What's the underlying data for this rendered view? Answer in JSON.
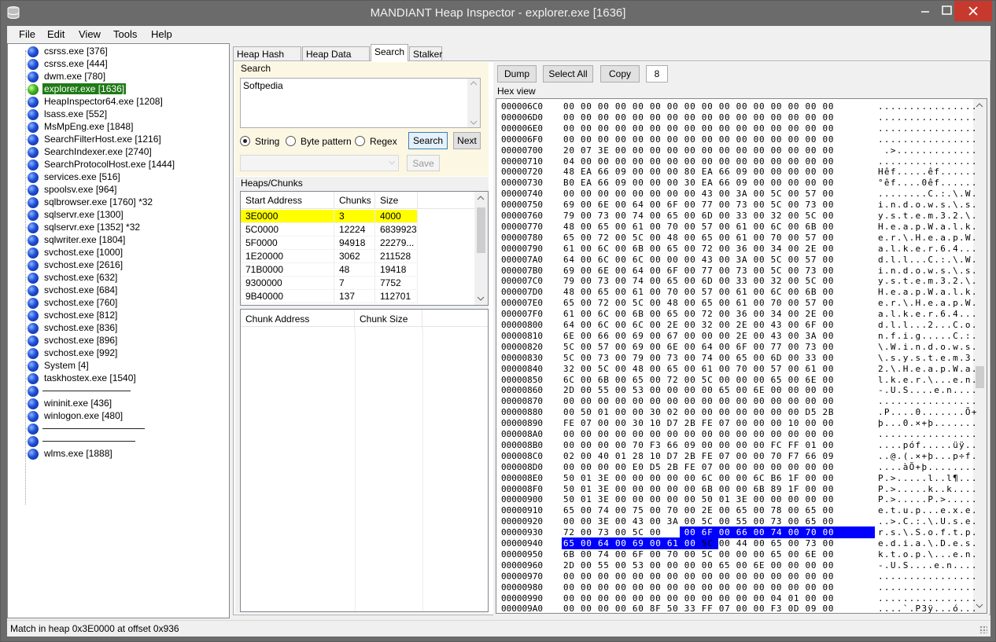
{
  "window": {
    "title": "MANDIANT Heap Inspector - explorer.exe [1636]",
    "close_color": "#c7382d"
  },
  "menu": [
    "File",
    "Edit",
    "View",
    "Tools",
    "Help"
  ],
  "processes": [
    {
      "label": "csrss.exe [376]"
    },
    {
      "label": "csrss.exe [444]"
    },
    {
      "label": "dwm.exe [780]"
    },
    {
      "label": "explorer.exe [1636]",
      "selected": true
    },
    {
      "label": "HeapInspector64.exe [1208]"
    },
    {
      "label": "lsass.exe [552]"
    },
    {
      "label": "MsMpEng.exe [1848]"
    },
    {
      "label": "SearchFilterHost.exe [1216]"
    },
    {
      "label": "SearchIndexer.exe [2740]"
    },
    {
      "label": "SearchProtocolHost.exe [1444]"
    },
    {
      "label": "services.exe [516]"
    },
    {
      "label": "spoolsv.exe [964]"
    },
    {
      "label": "sqlbrowser.exe [1760] *32"
    },
    {
      "label": "sqlservr.exe [1300]"
    },
    {
      "label": "sqlservr.exe [1352] *32"
    },
    {
      "label": "sqlwriter.exe [1804]"
    },
    {
      "label": "svchost.exe [1000]"
    },
    {
      "label": "svchost.exe [2616]"
    },
    {
      "label": "svchost.exe [632]"
    },
    {
      "label": "svchost.exe [684]"
    },
    {
      "label": "svchost.exe [760]"
    },
    {
      "label": "svchost.exe [812]"
    },
    {
      "label": "svchost.exe [836]"
    },
    {
      "label": "svchost.exe [896]"
    },
    {
      "label": "svchost.exe [992]"
    },
    {
      "label": "System [4]"
    },
    {
      "label": "taskhostex.exe [1540]"
    },
    {
      "label": "",
      "redacted": true
    },
    {
      "label": "wininit.exe [436]"
    },
    {
      "label": "winlogon.exe [480]"
    },
    {
      "label": "",
      "redacted": true
    },
    {
      "label": "",
      "redacted": true
    },
    {
      "label": "wlms.exe [1888]"
    }
  ],
  "tabs": [
    "Heap Hash Map",
    "Heap Data Map",
    "Search",
    "Stalker"
  ],
  "active_tab": "Search",
  "search": {
    "group_title": "Search",
    "text": "Softpedia",
    "options": [
      "String",
      "Byte pattern",
      "Regex"
    ],
    "selected_option": "String",
    "search_button": "Search",
    "next_button": "Next",
    "save_button": "Save"
  },
  "heaps": {
    "group_title": "Heaps/Chunks",
    "columns": [
      "Start Address",
      "Chunks",
      "Size"
    ],
    "rows": [
      [
        "3E0000",
        "3",
        "4000"
      ],
      [
        "5C0000",
        "12224",
        "6839923"
      ],
      [
        "5F0000",
        "94918",
        "22279..."
      ],
      [
        "1E20000",
        "3062",
        "211528"
      ],
      [
        "71B0000",
        "48",
        "19418"
      ],
      [
        "9300000",
        "7",
        "7752"
      ],
      [
        "9B40000",
        "137",
        "112701"
      ]
    ],
    "highlight_row": 0,
    "highlight_color": "#ffff00",
    "chunk_columns": [
      "Chunk Address",
      "Chunk Size"
    ]
  },
  "hex": {
    "buttons": [
      "Dump",
      "Select All",
      "Copy",
      "8"
    ],
    "group_title": "Hex view",
    "selection_color": "#0000ff",
    "rows": [
      {
        "off": "000006C0",
        "bytes": "00 00 00 00 00 00 00 00 00 00 00 00 00 00 00 00",
        "ascii": "................"
      },
      {
        "off": "000006D0",
        "bytes": "00 00 00 00 00 00 00 00 00 00 00 00 00 00 00 00",
        "ascii": "................"
      },
      {
        "off": "000006E0",
        "bytes": "00 00 00 00 00 00 00 00 00 00 00 00 00 00 00 00",
        "ascii": "................"
      },
      {
        "off": "000006F0",
        "bytes": "00 00 00 00 00 00 00 00 00 00 00 00 00 00 00 00",
        "ascii": "................"
      },
      {
        "off": "00000700",
        "bytes": "20 07 3E 00 00 00 00 00 00 00 00 00 00 00 00 00",
        "ascii": " .>............."
      },
      {
        "off": "00000710",
        "bytes": "04 00 00 00 00 00 00 00 00 00 00 00 00 00 00 00",
        "ascii": "................"
      },
      {
        "off": "00000720",
        "bytes": "48 EA 66 09 00 00 00 80 EA 66 09 00 00 00 00 00",
        "ascii": "Hêf.....êf......"
      },
      {
        "off": "00000730",
        "bytes": "B0 EA 66 09 00 00 00 30 EA 66 09 00 00 00 00 00",
        "ascii": "°êf....0êf......"
      },
      {
        "off": "00000740",
        "bytes": "00 00 00 00 00 00 00 00 43 00 3A 00 5C 00 57 00",
        "ascii": "........C.:.\\.W."
      },
      {
        "off": "00000750",
        "bytes": "69 00 6E 00 64 00 6F 00 77 00 73 00 5C 00 73 00",
        "ascii": "i.n.d.o.w.s.\\.s."
      },
      {
        "off": "00000760",
        "bytes": "79 00 73 00 74 00 65 00 6D 00 33 00 32 00 5C 00",
        "ascii": "y.s.t.e.m.3.2.\\."
      },
      {
        "off": "00000770",
        "bytes": "48 00 65 00 61 00 70 00 57 00 61 00 6C 00 6B 00",
        "ascii": "H.e.a.p.W.a.l.k."
      },
      {
        "off": "00000780",
        "bytes": "65 00 72 00 5C 00 48 00 65 00 61 00 70 00 57 00",
        "ascii": "e.r.\\.H.e.a.p.W."
      },
      {
        "off": "00000790",
        "bytes": "61 00 6C 00 6B 00 65 00 72 00 36 00 34 00 2E 00",
        "ascii": "a.l.k.e.r.6.4..."
      },
      {
        "off": "000007A0",
        "bytes": "64 00 6C 00 6C 00 00 00 43 00 3A 00 5C 00 57 00",
        "ascii": "d.l.l...C.:.\\.W."
      },
      {
        "off": "000007B0",
        "bytes": "69 00 6E 00 64 00 6F 00 77 00 73 00 5C 00 73 00",
        "ascii": "i.n.d.o.w.s.\\.s."
      },
      {
        "off": "000007C0",
        "bytes": "79 00 73 00 74 00 65 00 6D 00 33 00 32 00 5C 00",
        "ascii": "y.s.t.e.m.3.2.\\."
      },
      {
        "off": "000007D0",
        "bytes": "48 00 65 00 61 00 70 00 57 00 61 00 6C 00 6B 00",
        "ascii": "H.e.a.p.W.a.l.k."
      },
      {
        "off": "000007E0",
        "bytes": "65 00 72 00 5C 00 48 00 65 00 61 00 70 00 57 00",
        "ascii": "e.r.\\.H.e.a.p.W."
      },
      {
        "off": "000007F0",
        "bytes": "61 00 6C 00 6B 00 65 00 72 00 36 00 34 00 2E 00",
        "ascii": "a.l.k.e.r.6.4..."
      },
      {
        "off": "00000800",
        "bytes": "64 00 6C 00 6C 00 2E 00 32 00 2E 00 43 00 6F 00",
        "ascii": "d.l.l...2...C.o."
      },
      {
        "off": "00000810",
        "bytes": "6E 00 66 00 69 00 67 00 00 00 2E 00 43 00 3A 00",
        "ascii": "n.f.i.g.....C.:."
      },
      {
        "off": "00000820",
        "bytes": "5C 00 57 00 69 00 6E 00 64 00 6F 00 77 00 73 00",
        "ascii": "\\.W.i.n.d.o.w.s."
      },
      {
        "off": "00000830",
        "bytes": "5C 00 73 00 79 00 73 00 74 00 65 00 6D 00 33 00",
        "ascii": "\\.s.y.s.t.e.m.3."
      },
      {
        "off": "00000840",
        "bytes": "32 00 5C 00 48 00 65 00 61 00 70 00 57 00 61 00",
        "ascii": "2.\\.H.e.a.p.W.a."
      },
      {
        "off": "00000850",
        "bytes": "6C 00 6B 00 65 00 72 00 5C 00 00 00 65 00 6E 00",
        "ascii": "l.k.e.r.\\...e.n."
      },
      {
        "off": "00000860",
        "bytes": "2D 00 55 00 53 00 00 00 00 65 00 6E 00 00 00 00",
        "ascii": "-.U.S....e.n...."
      },
      {
        "off": "00000870",
        "bytes": "00 00 00 00 00 00 00 00 00 00 00 00 00 00 00 00",
        "ascii": "................"
      },
      {
        "off": "00000880",
        "bytes": "00 50 01 00 00 30 02 00 00 00 00 00 00 00 D5 2B",
        "ascii": ".P....0.......Õ+"
      },
      {
        "off": "00000890",
        "bytes": "FE 07 00 00 30 10 D7 2B FE 07 00 00 00 10 00 00",
        "ascii": "þ...0.×+þ......."
      },
      {
        "off": "000008A0",
        "bytes": "00 00 00 00 00 00 00 00 00 00 00 00 00 00 00 00",
        "ascii": "................"
      },
      {
        "off": "000008B0",
        "bytes": "00 00 00 00 70 F3 66 09 00 00 00 00 FC FF 01 00",
        "ascii": "....póf.....üÿ.."
      },
      {
        "off": "000008C0",
        "bytes": "02 00 40 01 28 10 D7 2B FE 07 00 00 70 F7 66 09",
        "ascii": "..@.(.×+þ...p÷f."
      },
      {
        "off": "000008D0",
        "bytes": "00 00 00 00 E0 D5 2B FE 07 00 00 00 00 00 00 00",
        "ascii": "....àÕ+þ........"
      },
      {
        "off": "000008E0",
        "bytes": "50 01 3E 00 00 00 00 00 6C 00 00 6C B6 1F 00 00",
        "ascii": "P.>.....l..l¶..."
      },
      {
        "off": "000008F0",
        "bytes": "50 01 3E 00 00 00 00 00 6B 00 00 6B 89 1F 00 00",
        "ascii": "P.>.....k..k...."
      },
      {
        "off": "00000900",
        "bytes": "50 01 3E 00 00 00 00 00 50 01 3E 00 00 00 00 00",
        "ascii": "P.>.....P.>....."
      },
      {
        "off": "00000910",
        "bytes": "65 00 74 00 75 00 70 00 2E 00 65 00 78 00 65 00",
        "ascii": "e.t.u.p...e.x.e."
      },
      {
        "off": "00000920",
        "bytes": "00 00 3E 00 43 00 3A 00 5C 00 55 00 73 00 65 00",
        "ascii": "..>.C.:.\\.U.s.e."
      },
      {
        "off": "00000930",
        "bytes": "72 00 73 00 5C 00 53 00 6F 00 66 00 74 00 70 00",
        "ascii": "r.s.\\.S.o.f.t.p.",
        "sel_start": 6,
        "sel_end": 16
      },
      {
        "off": "00000940",
        "bytes": "65 00 64 00 69 00 61 00 5C 00 44 00 65 00 73 00",
        "ascii": "e.d.i.a.\\.D.e.s.",
        "sel_start": 0,
        "sel_end": 8
      },
      {
        "off": "00000950",
        "bytes": "6B 00 74 00 6F 00 70 00 5C 00 00 00 65 00 6E 00",
        "ascii": "k.t.o.p.\\...e.n."
      },
      {
        "off": "00000960",
        "bytes": "2D 00 55 00 53 00 00 00 00 65 00 6E 00 00 00 00",
        "ascii": "-.U.S....e.n...."
      },
      {
        "off": "00000970",
        "bytes": "00 00 00 00 00 00 00 00 00 00 00 00 00 00 00 00",
        "ascii": "................"
      },
      {
        "off": "00000980",
        "bytes": "00 00 00 00 00 00 00 00 00 00 00 00 00 00 00 00",
        "ascii": "................"
      },
      {
        "off": "00000990",
        "bytes": "00 00 00 00 00 00 00 00 00 00 00 00 04 01 00 00",
        "ascii": "................"
      },
      {
        "off": "000009A0",
        "bytes": "00 00 00 00 60 8F 50 33 FF 07 00 00 F3 0D 09 00",
        "ascii": "....`.P3ÿ...ó..."
      }
    ]
  },
  "status": {
    "text": "Match in heap 0x3E0000 at offset 0x936"
  }
}
